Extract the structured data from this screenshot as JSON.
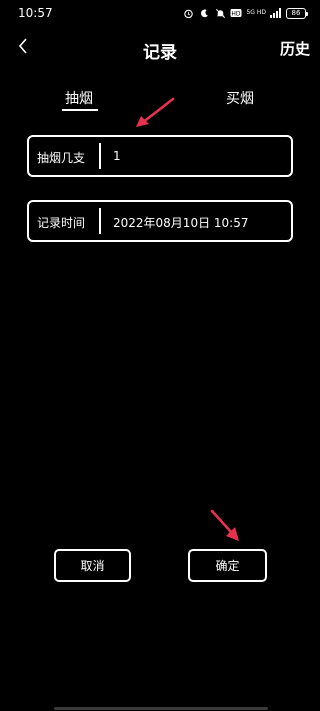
{
  "status_bar": {
    "time": "10:57",
    "network_text": "5G HD",
    "battery": "86"
  },
  "header": {
    "title": "记录",
    "history": "历史"
  },
  "tabs": [
    {
      "label": "抽烟",
      "active": true
    },
    {
      "label": "买烟",
      "active": false
    }
  ],
  "form": {
    "count_label": "抽烟几支",
    "count_value": "1",
    "time_label": "记录时间",
    "time_value": "2022年08月10日 10:57"
  },
  "buttons": {
    "cancel": "取消",
    "confirm": "确定"
  },
  "colors": {
    "background": "#000000",
    "foreground": "#ffffff",
    "annotation_arrow": "#e8314f"
  },
  "icons": {
    "back": "chevron-left-icon",
    "alarm": "alarm-icon",
    "dnd": "dnd-icon",
    "mute": "mute-icon"
  }
}
